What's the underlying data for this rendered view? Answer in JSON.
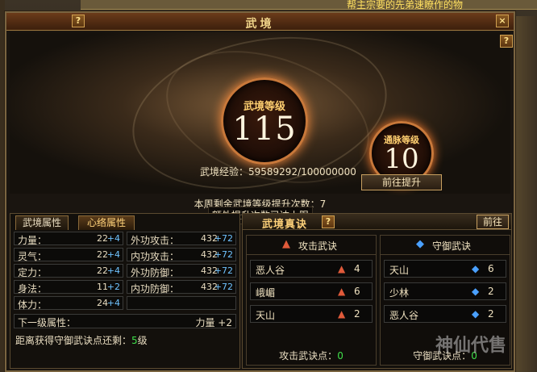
{
  "background": {
    "top_text": "帮主宗要的先弟速瞭作的物"
  },
  "window": {
    "title": "武境",
    "help": "?",
    "close": "×"
  },
  "hero": {
    "level_label": "武境等级",
    "level": "115",
    "meridian_label": "通脉等级",
    "meridian_level": "10",
    "exp_text": "武境经验：59589292/100000000",
    "upgrade_button": "前往提升",
    "weekly_text": "本周剩余武境等级提升次数：7",
    "extra_text": "额外提升次数已达上限"
  },
  "attributes": {
    "tabs": [
      "武境属性",
      "心络属性"
    ],
    "rows": [
      {
        "left": {
          "name": "力量：",
          "value": "22",
          "bonus": "+4"
        },
        "right": {
          "name": "外功攻击：",
          "value": "432",
          "bonus": "+72"
        }
      },
      {
        "left": {
          "name": "灵气：",
          "value": "22",
          "bonus": "+4"
        },
        "right": {
          "name": "内功攻击：",
          "value": "432",
          "bonus": "+72"
        }
      },
      {
        "left": {
          "name": "定力：",
          "value": "22",
          "bonus": "+4"
        },
        "right": {
          "name": "外功防御：",
          "value": "432",
          "bonus": "+72"
        }
      },
      {
        "left": {
          "name": "身法：",
          "value": "11",
          "bonus": "+2"
        },
        "right": {
          "name": "内功防御：",
          "value": "432",
          "bonus": "+72"
        }
      },
      {
        "left": {
          "name": "体力：",
          "value": "24",
          "bonus": "+4"
        },
        "right": {
          "name": "",
          "value": "",
          "bonus": ""
        }
      }
    ],
    "next_label": "下一级属性：",
    "next_value": "力量  +2",
    "remain_prefix": "距离获得守御武诀点还剩：",
    "remain_value": "5",
    "remain_suffix": "级"
  },
  "formula": {
    "title": "武境真诀",
    "goto_button": "前往",
    "attack": {
      "title": "攻击武诀",
      "rows": [
        {
          "name": "恶人谷",
          "num": "4"
        },
        {
          "name": "峨嵋",
          "num": "6"
        },
        {
          "name": "天山",
          "num": "2"
        }
      ],
      "points_label": "攻击武诀点：",
      "points": "0"
    },
    "defense": {
      "title": "守御武诀",
      "rows": [
        {
          "name": "天山",
          "num": "6"
        },
        {
          "name": "少林",
          "num": "2"
        },
        {
          "name": "恶人谷",
          "num": "2"
        }
      ],
      "points_label": "守御武诀点：",
      "points": "0"
    }
  },
  "watermark": "神仙代售"
}
